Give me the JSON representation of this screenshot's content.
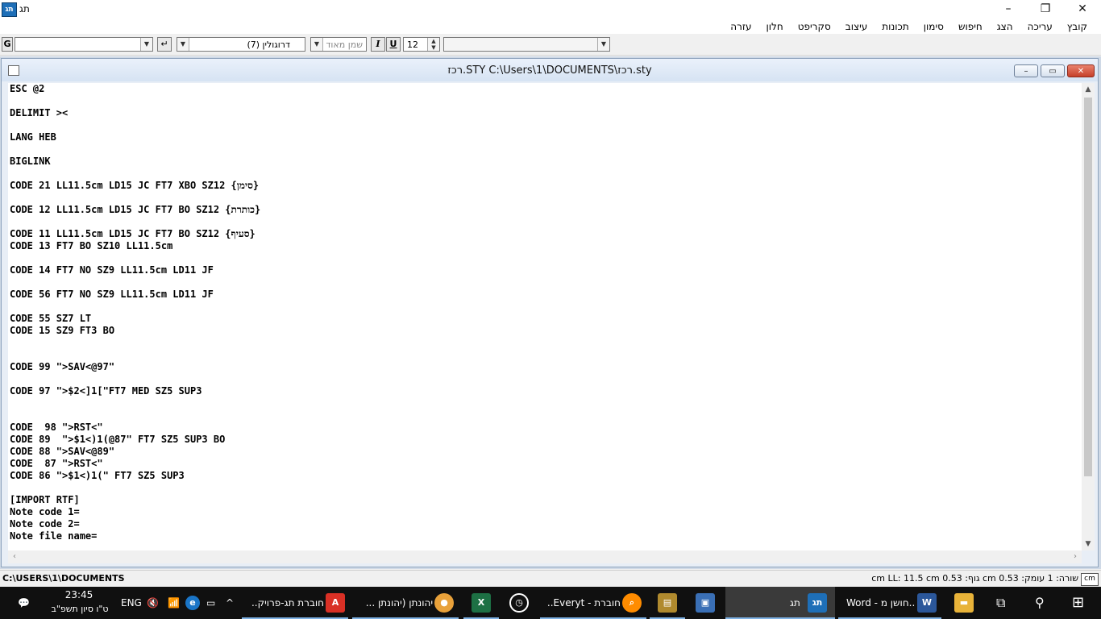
{
  "window": {
    "title": "תג",
    "app_icon": "תג"
  },
  "menu": [
    "קובץ",
    "עריכה",
    "הצג",
    "חיפוש",
    "סימון",
    "תכונות",
    "עיצוב",
    "סקריפט",
    "חלון",
    "עזרה"
  ],
  "toolbar": {
    "g_label": "G",
    "font_name": "דרוגולין (7)",
    "weight": "שמן מאוד",
    "italic": "I",
    "underline": "U",
    "size": "12"
  },
  "document": {
    "title": "רכז.STY  C:\\Users\\1\\DOCUMENTS\\רכז.sty",
    "lines": [
      "ESC @2",
      "",
      "DELIMIT ><",
      "",
      "LANG HEB",
      "",
      "BIGLINK",
      "",
      "CODE 21 LL11.5cm LD15 JC FT7 XBO SZ12 {סימן}",
      "",
      "CODE 12 LL11.5cm LD15 JC FT7 BO SZ12 {כותרת}",
      "",
      "CODE 11 LL11.5cm LD15 JC FT7 BO SZ12 {סעיף}",
      "CODE 13 FT7 BO SZ10 LL11.5cm",
      "",
      "CODE 14 FT7 NO SZ9 LL11.5cm LD11 JF",
      "",
      "CODE 56 FT7 NO SZ9 LL11.5cm LD11 JF",
      "",
      "CODE 55 SZ7 LT",
      "CODE 15 SZ9 FT3 BO",
      "",
      "",
      "CODE 99 \">SAV<@97\"",
      "",
      "CODE 97 \">$2<]1[\"FT7 MED SZ5 SUP3",
      "",
      "",
      "CODE  98 \">RST<\"",
      "CODE 89  \">$1<)1(@87\" FT7 SZ5 SUP3 BO",
      "CODE 88 \">SAV<@89\"",
      "CODE  87 \">RST<\"",
      "CODE 86 \">$1<)1(\" FT7 SZ5 SUP3",
      "",
      "[IMPORT RTF]",
      "Note code 1=",
      "Note code 2=",
      "Note file name="
    ]
  },
  "status": {
    "path": "C:\\USERS\\1\\DOCUMENTS",
    "metrics": "שורה: 1  עומק: 0.53 cm  גוף: 0.53 cm  LL: 11.5 cm",
    "unit": "cm"
  },
  "taskbar": {
    "lang": "ENG",
    "time": "23:45",
    "date": "ט\"ו סיון תשפ\"ב",
    "apps": [
      {
        "label": "חוברת תג-פרויק...",
        "icon": "pdf-icon"
      },
      {
        "label": "יהונתן (יהונתן ...",
        "icon": "chrome-icon"
      },
      {
        "label": "",
        "icon": "excel-icon"
      },
      {
        "label": "",
        "icon": "clock-icon"
      },
      {
        "label": "חוברת - Everyt...",
        "icon": "search-app-icon"
      },
      {
        "label": "",
        "icon": "archive-icon"
      },
      {
        "label": "",
        "icon": "book-icon"
      },
      {
        "label": "תג",
        "icon": "tag-app-icon"
      },
      {
        "label": "Word - חושן מ...",
        "icon": "word-icon"
      },
      {
        "label": "",
        "icon": "folder-icon"
      },
      {
        "label": "",
        "icon": "task-view-icon"
      },
      {
        "label": "",
        "icon": "search-icon"
      },
      {
        "label": "",
        "icon": "start-icon"
      }
    ]
  },
  "colors": {
    "accent": "#1e6fb8",
    "close": "#c6402a",
    "taskbar": "#101010"
  }
}
